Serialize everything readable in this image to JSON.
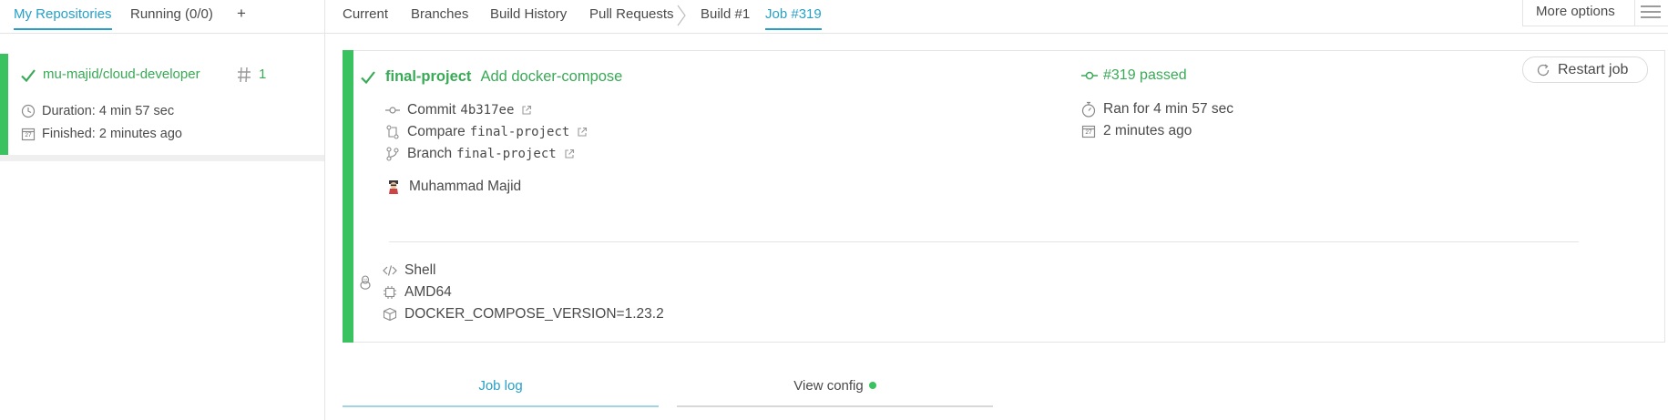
{
  "sidebar": {
    "tabs": [
      {
        "label": "My Repositories",
        "active": true
      },
      {
        "label": "Running (0/0)",
        "active": false
      }
    ],
    "add_label": "+",
    "repo": {
      "name": "mu-majid/cloud-developer",
      "build_number": "1",
      "duration": "Duration: 4 min 57 sec",
      "finished": "Finished: 2 minutes ago",
      "calendar_day": "27",
      "status_color": "#39c25f"
    }
  },
  "nav": {
    "items": [
      "Current",
      "Branches",
      "Build History",
      "Pull Requests",
      "Build #1",
      "Job #319"
    ],
    "active_index": 5,
    "more_options": "More options"
  },
  "job": {
    "branch": "final-project",
    "message": "Add docker-compose",
    "status": "#319 passed",
    "restart_label": "Restart job",
    "commit_label": "Commit",
    "commit_sha": "4b317ee",
    "compare_label": "Compare",
    "compare_ref": "final-project",
    "branch_label": "Branch",
    "branch_ref": "final-project",
    "author": "Muhammad Majid",
    "ran_for": "Ran for 4 min 57 sec",
    "finished_ago": "2 minutes ago",
    "calendar_day": "27",
    "language": "Shell",
    "arch": "AMD64",
    "env": "DOCKER_COMPOSE_VERSION=1.23.2"
  },
  "bottom_tabs": [
    {
      "label": "Job log",
      "active": true
    },
    {
      "label": "View config",
      "active": false,
      "status_dot": true
    }
  ],
  "colors": {
    "accent": "#27a0c7",
    "passed": "#39aa56",
    "stripe": "#39c25f"
  }
}
